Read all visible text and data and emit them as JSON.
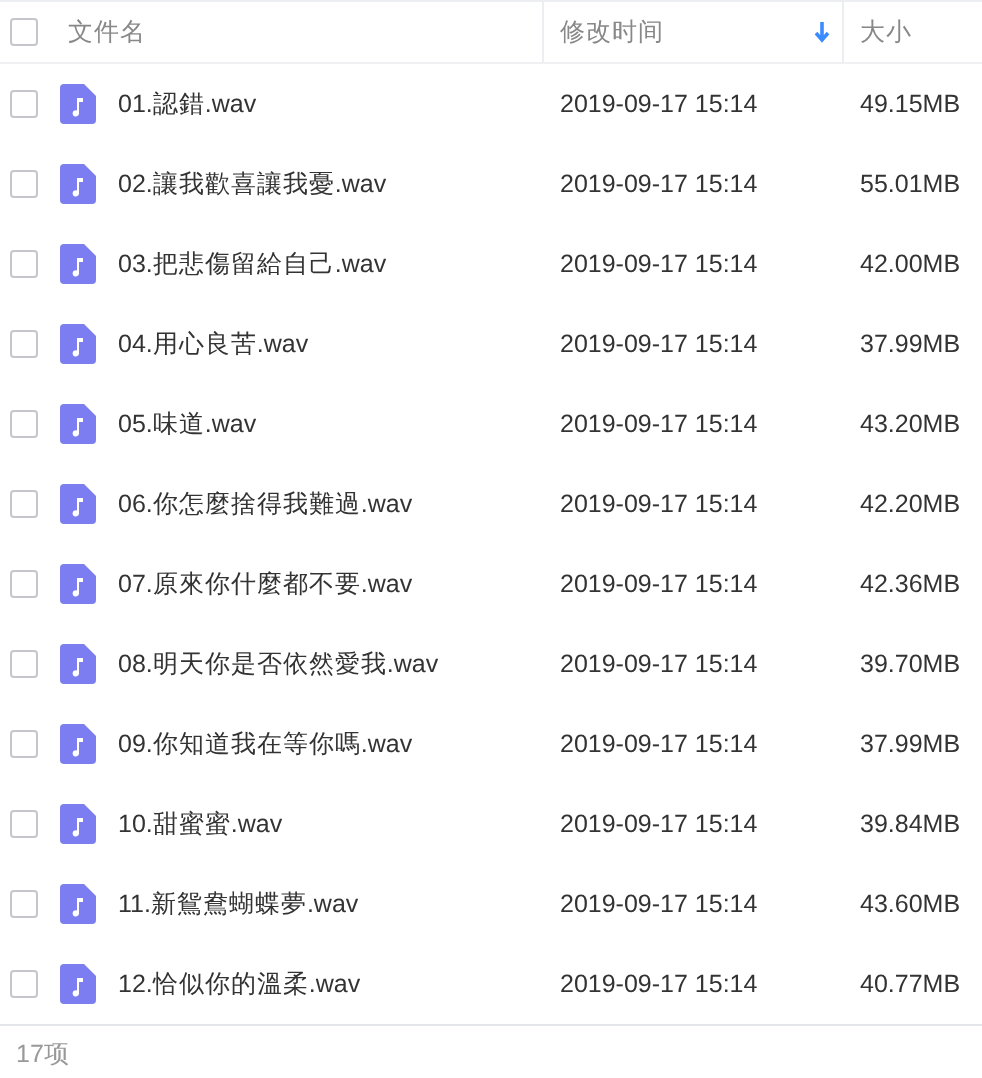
{
  "table": {
    "select_all": {
      "checked": false
    },
    "columns": [
      {
        "label": "文件名",
        "sorted": false
      },
      {
        "label": "修改时间",
        "sorted": true
      },
      {
        "label": "大小",
        "sorted": false
      }
    ],
    "rows": [
      {
        "checked": false,
        "name": "01.認錯.wav",
        "modified": "2019-09-17 15:14",
        "size": "49.15MB"
      },
      {
        "checked": false,
        "name": "02.讓我歡喜讓我憂.wav",
        "modified": "2019-09-17 15:14",
        "size": "55.01MB"
      },
      {
        "checked": false,
        "name": "03.把悲傷留給自己.wav",
        "modified": "2019-09-17 15:14",
        "size": "42.00MB"
      },
      {
        "checked": false,
        "name": "04.用心良苦.wav",
        "modified": "2019-09-17 15:14",
        "size": "37.99MB"
      },
      {
        "checked": false,
        "name": "05.味道.wav",
        "modified": "2019-09-17 15:14",
        "size": "43.20MB"
      },
      {
        "checked": false,
        "name": "06.你怎麼捨得我難過.wav",
        "modified": "2019-09-17 15:14",
        "size": "42.20MB"
      },
      {
        "checked": false,
        "name": "07.原來你什麼都不要.wav",
        "modified": "2019-09-17 15:14",
        "size": "42.36MB"
      },
      {
        "checked": false,
        "name": "08.明天你是否依然愛我.wav",
        "modified": "2019-09-17 15:14",
        "size": "39.70MB"
      },
      {
        "checked": false,
        "name": "09.你知道我在等你嗎.wav",
        "modified": "2019-09-17 15:14",
        "size": "37.99MB"
      },
      {
        "checked": false,
        "name": "10.甜蜜蜜.wav",
        "modified": "2019-09-17 15:14",
        "size": "39.84MB"
      },
      {
        "checked": false,
        "name": "11.新鴛鴦蝴蝶夢.wav",
        "modified": "2019-09-17 15:14",
        "size": "43.60MB"
      },
      {
        "checked": false,
        "name": "12.恰似你的溫柔.wav",
        "modified": "2019-09-17 15:14",
        "size": "40.77MB"
      }
    ]
  },
  "status_bar": {
    "count": "17项"
  }
}
